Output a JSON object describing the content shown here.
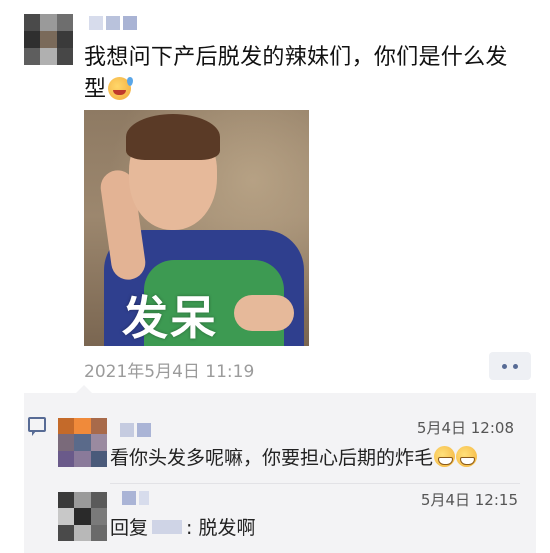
{
  "post": {
    "text": "我想问下产后脱发的辣妹们，你们是什么发型",
    "emoji": "sweat-smile-emoji",
    "image_caption": "发呆",
    "time": "2021年5月4日 11:19"
  },
  "comments": [
    {
      "time": "5月4日 12:08",
      "text": "看你头发多呢嘛，你要担心后期的炸毛",
      "emoji": "grin-emoji"
    },
    {
      "time": "5月4日 12:15",
      "reply_prefix": "回复",
      "text": ": 脱发啊"
    }
  ],
  "colors": {
    "link_blue": "#576b95",
    "timestamp_gray": "#9b9b9b",
    "comment_bg": "#f3f3f5"
  }
}
